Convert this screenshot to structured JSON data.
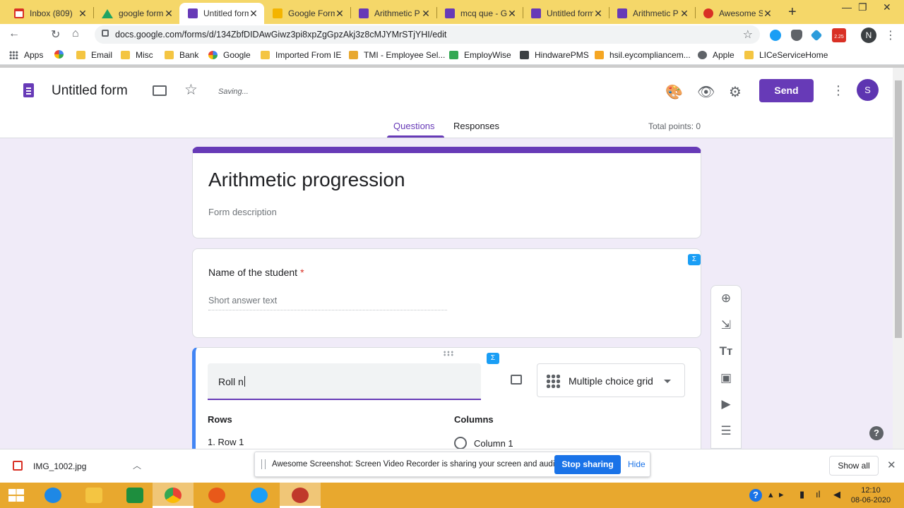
{
  "browser": {
    "tabs": [
      {
        "title": "Inbox (809)",
        "icon": "gmail-icon"
      },
      {
        "title": "google form",
        "icon": "drive-icon"
      },
      {
        "title": "Untitled form",
        "icon": "forms-icon",
        "active": true
      },
      {
        "title": "Google Form",
        "icon": "slides-icon"
      },
      {
        "title": "Arithmetic P",
        "icon": "forms-icon"
      },
      {
        "title": "mcq que - G",
        "icon": "forms-icon"
      },
      {
        "title": "Untitled form",
        "icon": "forms-icon"
      },
      {
        "title": "Arithmetic P",
        "icon": "forms-icon"
      },
      {
        "title": "Awesome Sc",
        "icon": "awesome-screenshot-icon"
      }
    ],
    "url": "docs.google.com/forms/d/134ZbfDIDAwGiwz3pi8xpZgGpzAkj3z8cMJYMrSTjYHI/edit",
    "download_badge": "2.25",
    "profile_initial": "N"
  },
  "bookmarks": [
    {
      "label": "Apps",
      "icon": "apps-grid-icon"
    },
    {
      "label": "",
      "icon": "google-g-icon"
    },
    {
      "label": "Email",
      "icon": "folder-icon"
    },
    {
      "label": "Misc",
      "icon": "folder-icon"
    },
    {
      "label": "Bank",
      "icon": "folder-icon"
    },
    {
      "label": "Google",
      "icon": "google-g-icon"
    },
    {
      "label": "Imported From IE",
      "icon": "folder-icon"
    },
    {
      "label": "TMI - Employee Sel...",
      "icon": "tmi-icon"
    },
    {
      "label": "EmployWise",
      "icon": "employwise-icon"
    },
    {
      "label": "HindwarePMS",
      "icon": "hindware-icon"
    },
    {
      "label": "hsil.eycompliancem...",
      "icon": "hsil-icon"
    },
    {
      "label": "Apple",
      "icon": "apple-icon"
    },
    {
      "label": "LICeServiceHome",
      "icon": "lic-icon"
    }
  ],
  "form_header": {
    "title": "Untitled form",
    "status": "Saving...",
    "send_label": "Send",
    "avatar_initial": "S",
    "tabs": {
      "questions": "Questions",
      "responses": "Responses"
    },
    "total_points": "Total points: 0",
    "colors": {
      "accent": "#673ab7",
      "background": "#f0ebf8"
    }
  },
  "form": {
    "title": "Arithmetic progression",
    "description_placeholder": "Form description",
    "questions": [
      {
        "label": "Name of the student",
        "required_mark": "*",
        "answer_placeholder": "Short answer text"
      },
      {
        "title_value": "Roll n",
        "type": "Multiple choice grid",
        "rows_heading": "Rows",
        "columns_heading": "Columns",
        "row1": "1.  Row 1",
        "column1": "Column 1"
      }
    ]
  },
  "download_shelf": {
    "file_name": "IMG_1002.jpg",
    "share_message": "Awesome Screenshot: Screen Video Recorder is sharing your screen and audio.",
    "stop_label": "Stop sharing",
    "hide_label": "Hide",
    "show_all_label": "Show all"
  },
  "taskbar": {
    "time": "12:10",
    "date": "08-06-2020"
  }
}
